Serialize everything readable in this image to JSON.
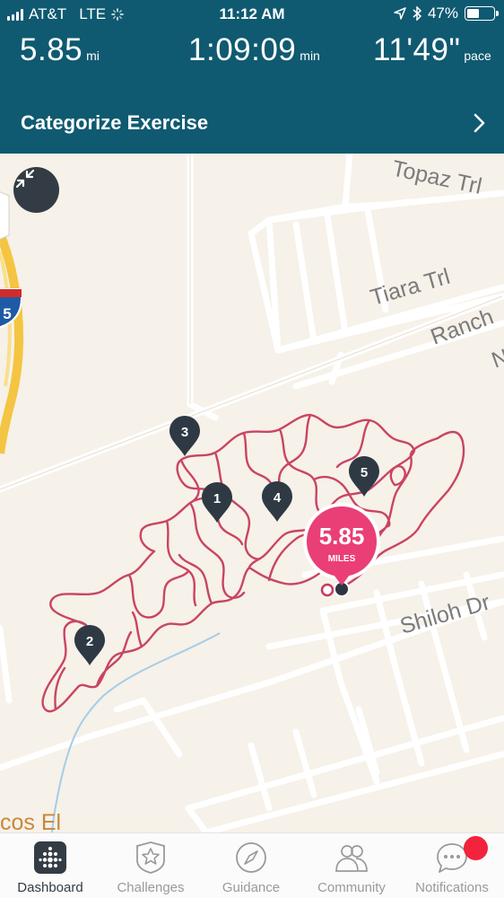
{
  "status_bar": {
    "carrier": "AT&T",
    "network": "LTE",
    "time": "11:12 AM",
    "battery_percent": "47%",
    "battery_level": 0.47
  },
  "stats": {
    "distance": {
      "value": "5.85",
      "unit": "mi"
    },
    "duration": {
      "value": "1:09:09",
      "unit": "min"
    },
    "pace": {
      "value": "11'49\"",
      "unit": "pace"
    }
  },
  "categorize": {
    "label": "Categorize Exercise"
  },
  "map": {
    "collapse_icon": "collapse-arrows-icon",
    "route_color": "#c63a5e",
    "summary_bubble": {
      "value": "5.85",
      "unit": "MILES",
      "color": "#ea3f76"
    },
    "mile_markers": [
      "1",
      "2",
      "3",
      "4",
      "5"
    ],
    "street_labels": {
      "topaz": "Topaz Trl",
      "tiara": "Tiara Trl",
      "ranch": "Ranch",
      "shiloh": "Shiloh Dr",
      "n": "N",
      "cos": "cos El"
    },
    "highway_shield": "5"
  },
  "tabbar": {
    "tabs": [
      {
        "label": "Dashboard",
        "icon": "dashboard-dots-icon",
        "active": true
      },
      {
        "label": "Challenges",
        "icon": "star-badge-icon",
        "active": false
      },
      {
        "label": "Guidance",
        "icon": "compass-icon",
        "active": false
      },
      {
        "label": "Community",
        "icon": "people-icon",
        "active": false
      },
      {
        "label": "Notifications",
        "icon": "chat-bubble-icon",
        "active": false
      }
    ]
  }
}
